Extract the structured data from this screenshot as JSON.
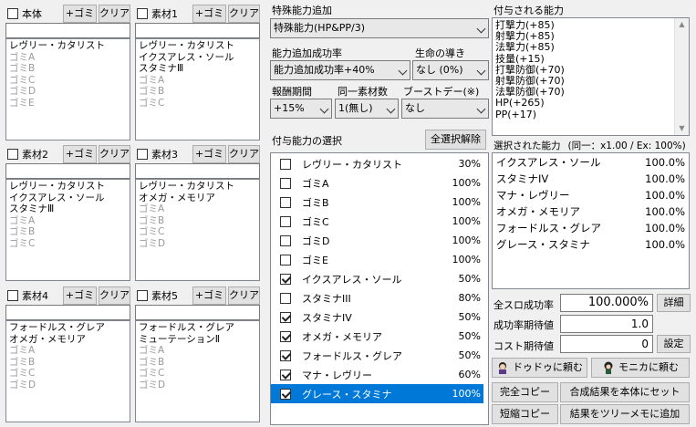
{
  "panels": [
    {
      "title": "本体",
      "gomi": "+ゴミ",
      "clear": "クリア",
      "checked": false,
      "lines": [
        {
          "t": "レヴリー・カタリスト",
          "g": false
        },
        {
          "t": "ゴミA",
          "g": true
        },
        {
          "t": "ゴミB",
          "g": true
        },
        {
          "t": "ゴミC",
          "g": true
        },
        {
          "t": "ゴミD",
          "g": true
        },
        {
          "t": "ゴミE",
          "g": true
        }
      ]
    },
    {
      "title": "素材1",
      "gomi": "+ゴミ",
      "clear": "クリア",
      "checked": false,
      "lines": [
        {
          "t": "レヴリー・カタリスト",
          "g": false
        },
        {
          "t": "イクスアレス・ソール",
          "g": false
        },
        {
          "t": "スタミナⅢ",
          "g": false
        },
        {
          "t": "ゴミA",
          "g": true
        },
        {
          "t": "ゴミB",
          "g": true
        },
        {
          "t": "ゴミC",
          "g": true
        }
      ]
    },
    {
      "title": "素材2",
      "gomi": "+ゴミ",
      "clear": "クリア",
      "checked": false,
      "lines": [
        {
          "t": "レヴリー・カタリスト",
          "g": false
        },
        {
          "t": "イクスアレス・ソール",
          "g": false
        },
        {
          "t": "スタミナⅢ",
          "g": false
        },
        {
          "t": "ゴミA",
          "g": true
        },
        {
          "t": "ゴミB",
          "g": true
        },
        {
          "t": "ゴミC",
          "g": true
        }
      ]
    },
    {
      "title": "素材3",
      "gomi": "+ゴミ",
      "clear": "クリア",
      "checked": false,
      "lines": [
        {
          "t": "レヴリー・カタリスト",
          "g": false
        },
        {
          "t": "オメガ・メモリア",
          "g": false
        },
        {
          "t": "ゴミA",
          "g": true
        },
        {
          "t": "ゴミB",
          "g": true
        },
        {
          "t": "ゴミC",
          "g": true
        },
        {
          "t": "ゴミD",
          "g": true
        }
      ]
    },
    {
      "title": "素材4",
      "gomi": "+ゴミ",
      "clear": "クリア",
      "checked": false,
      "lines": [
        {
          "t": "フォードルス・グレア",
          "g": false
        },
        {
          "t": "オメガ・メモリア",
          "g": false
        },
        {
          "t": "ゴミA",
          "g": true
        },
        {
          "t": "ゴミB",
          "g": true
        },
        {
          "t": "ゴミC",
          "g": true
        },
        {
          "t": "ゴミD",
          "g": true
        }
      ]
    },
    {
      "title": "素材5",
      "gomi": "+ゴミ",
      "clear": "クリア",
      "checked": false,
      "lines": [
        {
          "t": "フォードルス・グレア",
          "g": false
        },
        {
          "t": "ミューテーションⅡ",
          "g": false
        },
        {
          "t": "ゴミA",
          "g": true
        },
        {
          "t": "ゴミB",
          "g": true
        },
        {
          "t": "ゴミC",
          "g": true
        },
        {
          "t": "ゴミD",
          "g": true
        }
      ]
    }
  ],
  "special": {
    "label": "特殊能力追加",
    "value": "特殊能力(HP&PP/3)"
  },
  "rate": {
    "label": "能力追加成功率",
    "value": "能力追加成功率+40%"
  },
  "guide": {
    "label": "生命の導き",
    "value": "なし (0%)"
  },
  "reward": {
    "label": "報酬期間",
    "value": "+15%"
  },
  "same": {
    "label": "同一素材数",
    "value": "1(無し)"
  },
  "boost": {
    "label": "ブーストデー(※)",
    "value": "なし"
  },
  "ability_select": {
    "label": "付与能力の選択",
    "deselect_all": "全選択解除"
  },
  "abilities": [
    {
      "name": "レヴリー・カタリスト",
      "pct": "30%",
      "checked": false,
      "selected": false
    },
    {
      "name": "ゴミA",
      "pct": "100%",
      "checked": false,
      "selected": false
    },
    {
      "name": "ゴミB",
      "pct": "100%",
      "checked": false,
      "selected": false
    },
    {
      "name": "ゴミC",
      "pct": "100%",
      "checked": false,
      "selected": false
    },
    {
      "name": "ゴミD",
      "pct": "100%",
      "checked": false,
      "selected": false
    },
    {
      "name": "ゴミE",
      "pct": "100%",
      "checked": false,
      "selected": false
    },
    {
      "name": "イクスアレス・ソール",
      "pct": "50%",
      "checked": true,
      "selected": false
    },
    {
      "name": "スタミナIII",
      "pct": "80%",
      "checked": false,
      "selected": false
    },
    {
      "name": "スタミナIV",
      "pct": "50%",
      "checked": true,
      "selected": false
    },
    {
      "name": "オメガ・メモリア",
      "pct": "50%",
      "checked": true,
      "selected": false
    },
    {
      "name": "フォードルス・グレア",
      "pct": "50%",
      "checked": true,
      "selected": false
    },
    {
      "name": "マナ・レヴリー",
      "pct": "60%",
      "checked": true,
      "selected": false
    },
    {
      "name": "グレース・スタミナ",
      "pct": "100%",
      "checked": true,
      "selected": true
    }
  ],
  "granted": {
    "label": "付与される能力",
    "lines": [
      "打撃力(+85)",
      "射撃力(+85)",
      "法撃力(+85)",
      "技量(+15)",
      "打撃防御(+70)",
      "射撃防御(+70)",
      "法撃防御(+70)",
      "HP(+265)",
      "PP(+17)"
    ]
  },
  "selected": {
    "label": "選択された能力",
    "info": "(同一：x1.00 / Ex: 100%)",
    "rows": [
      {
        "name": "イクスアレス・ソール",
        "pct": "100.0%"
      },
      {
        "name": "スタミナIV",
        "pct": "100.0%"
      },
      {
        "name": "マナ・レヴリー",
        "pct": "100.0%"
      },
      {
        "name": "オメガ・メモリア",
        "pct": "100.0%"
      },
      {
        "name": "フォードルス・グレア",
        "pct": "100.0%"
      },
      {
        "name": "グレース・スタミナ",
        "pct": "100.0%"
      }
    ]
  },
  "stats": {
    "success_label": "全スロ成功率",
    "success_value": "100.000%",
    "detail": "詳細",
    "expect_label": "成功率期待値",
    "expect_value": "1.0",
    "cost_label": "コスト期待値",
    "cost_value": "0",
    "settings": "設定"
  },
  "actions": {
    "dodoo": "ドゥドゥに頼む",
    "monica": "モニカに頼む",
    "full_copy": "完全コピー",
    "set_result": "合成結果を本体にセット",
    "short_copy": "短縮コピー",
    "tree_memo": "結果をツリーメモに追加"
  }
}
